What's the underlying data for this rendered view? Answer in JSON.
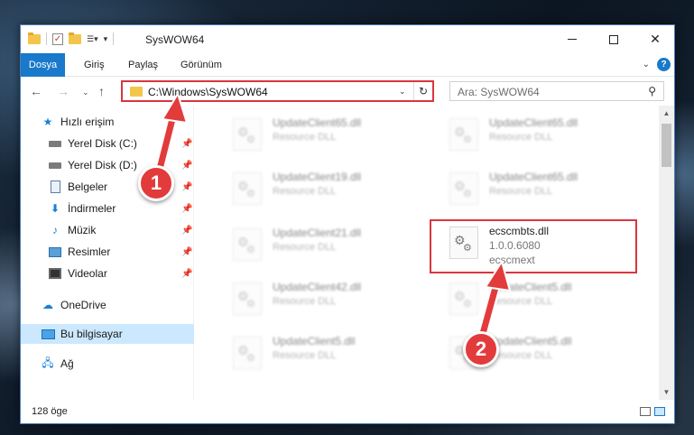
{
  "window": {
    "title": "SysWOW64"
  },
  "ribbon": {
    "tabs": [
      {
        "label": "Dosya"
      },
      {
        "label": "Giriş"
      },
      {
        "label": "Paylaş"
      },
      {
        "label": "Görünüm"
      }
    ],
    "help": "?"
  },
  "nav": {
    "address": "C:\\Windows\\SysWOW64",
    "search_placeholder": "Ara: SysWOW64"
  },
  "sidebar": {
    "items": [
      {
        "label": "Hızlı erişim",
        "icon": "star-icon"
      },
      {
        "label": "Yerel Disk (C:)",
        "icon": "disk-icon",
        "pinned": true
      },
      {
        "label": "Yerel Disk (D:)",
        "icon": "disk-icon",
        "pinned": true
      },
      {
        "label": "Belgeler",
        "icon": "document-icon",
        "pinned": true
      },
      {
        "label": "İndirmeler",
        "icon": "download-icon",
        "pinned": true
      },
      {
        "label": "Müzik",
        "icon": "music-icon",
        "pinned": true
      },
      {
        "label": "Resimler",
        "icon": "picture-icon",
        "pinned": true
      },
      {
        "label": "Videolar",
        "icon": "video-icon",
        "pinned": true
      },
      {
        "label": "OneDrive",
        "icon": "cloud-icon"
      },
      {
        "label": "Bu bilgisayar",
        "icon": "computer-icon",
        "selected": true
      },
      {
        "label": "Ağ",
        "icon": "network-icon"
      }
    ]
  },
  "files": {
    "left": [
      {
        "name": "UpdateClient65.dll",
        "desc": "Resource DLL"
      },
      {
        "name": "UpdateClient19.dll",
        "desc": "Resource DLL"
      },
      {
        "name": "UpdateClient21.dll",
        "desc": "Resource DLL"
      },
      {
        "name": "UpdateClient42.dll",
        "desc": "Resource DLL"
      },
      {
        "name": "UpdateClient5.dll",
        "desc": "Resource DLL"
      }
    ],
    "right": [
      {
        "name": "UpdateClient65.dll",
        "desc": "Resource DLL"
      },
      {
        "name": "UpdateClient65.dll",
        "desc": "Resource DLL"
      },
      {
        "name": "UpdateClient5.dll",
        "desc": "Resource DLL"
      },
      {
        "name": "UpdateClient5.dll",
        "desc": "Resource DLL"
      }
    ],
    "focus": {
      "name": "ecscmbts.dll",
      "version": "1.0.0.6080",
      "company": "ecscmext"
    }
  },
  "status": {
    "count": "128 öge"
  },
  "callouts": {
    "one": "1",
    "two": "2"
  },
  "colors": {
    "accent": "#1979ca",
    "highlight": "#d9363e",
    "selected": "#cce8ff"
  }
}
